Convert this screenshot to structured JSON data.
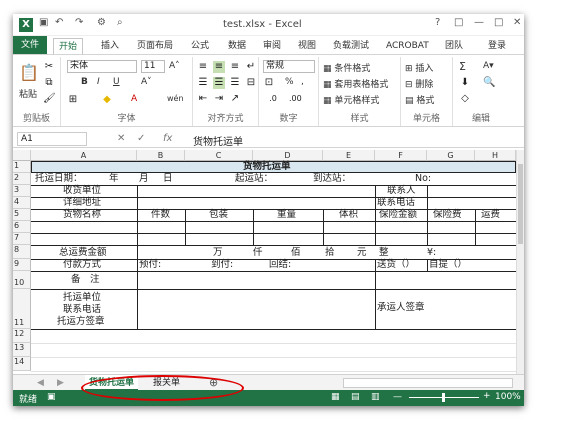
{
  "title_bar": {
    "filename": "test.xlsx - Excel",
    "help": "?",
    "restore": "□",
    "minimize": "—",
    "maximize": "□",
    "close": "✕"
  },
  "tabs": [
    "文件",
    "开始",
    "插入",
    "页面布局",
    "公式",
    "数据",
    "审阅",
    "视图",
    "负载测试",
    "ACROBAT",
    "团队",
    "登录"
  ],
  "ribbon": {
    "clipboard": {
      "label": "剪贴板",
      "paste": "粘贴"
    },
    "font": {
      "label": "字体",
      "name": "宋体",
      "size": "11",
      "bold": "B",
      "italic": "I",
      "underline": "U",
      "grow": "A˄",
      "shrink": "A˅",
      "color_a": "A",
      "wen": "wén"
    },
    "alignment": {
      "label": "对齐方式"
    },
    "number": {
      "label": "数字",
      "format": "常规",
      "pct": "%",
      "comma": ","
    },
    "styles": {
      "label": "样式",
      "cond": "条件格式",
      "table": "套用表格格式",
      "cell": "单元格样式"
    },
    "cells": {
      "label": "单元格",
      "insert": "插入",
      "delete": "删除",
      "format": "格式"
    },
    "editing": {
      "label": "编辑",
      "sum": "Σ",
      "sort": "A▾"
    }
  },
  "formula_bar": {
    "name_box": "A1",
    "fx": "fx",
    "content": "货物托运单"
  },
  "columns": [
    "A",
    "B",
    "C",
    "D",
    "E",
    "F",
    "G",
    "H"
  ],
  "rows": [
    "1",
    "2",
    "3",
    "4",
    "5",
    "6",
    "7",
    "8",
    "9",
    "10",
    "11",
    "12",
    "13",
    "14"
  ],
  "cells": {
    "r1": "货物托运单",
    "r2a": "托运日期：",
    "r2b": "年",
    "r2c": "月",
    "r2d": "日",
    "r2e": "起运站：",
    "r2f": "到达站：",
    "r2g": "No:",
    "r3a": "收货单位",
    "r3f": "联系人",
    "r4a": "详细地址",
    "r4f": "联系电话",
    "r5a": "货物名称",
    "r5b": "件数",
    "r5c": "包装",
    "r5d": "重量",
    "r5e": "体积",
    "r5f": "保险金额",
    "r5g": "保险费",
    "r5h": "运费",
    "r8a": "总运费金额",
    "r8c": "万",
    "r8d": "仟",
    "r8e": "佰",
    "r8f": "拾",
    "r8g": "元",
    "r8h": "整",
    "r8i": "¥:",
    "r9a": "付款方式",
    "r9b": "预付:",
    "r9c": "到付:",
    "r9d": "回结:",
    "r9f": "送货（）",
    "r9g": "自提（）",
    "r10a": "备　注",
    "r11a1": "托运单位",
    "r11a2": "联系电话",
    "r11a3": "托运方签章",
    "r11f": "承运人签章"
  },
  "sheets": {
    "active": "货物托运单",
    "other": "报关单",
    "add": "⊕",
    "prev": "◀",
    "next": "▶"
  },
  "status": {
    "ready": "就绪",
    "zoom": "100%",
    "minus": "—",
    "plus": "+"
  }
}
